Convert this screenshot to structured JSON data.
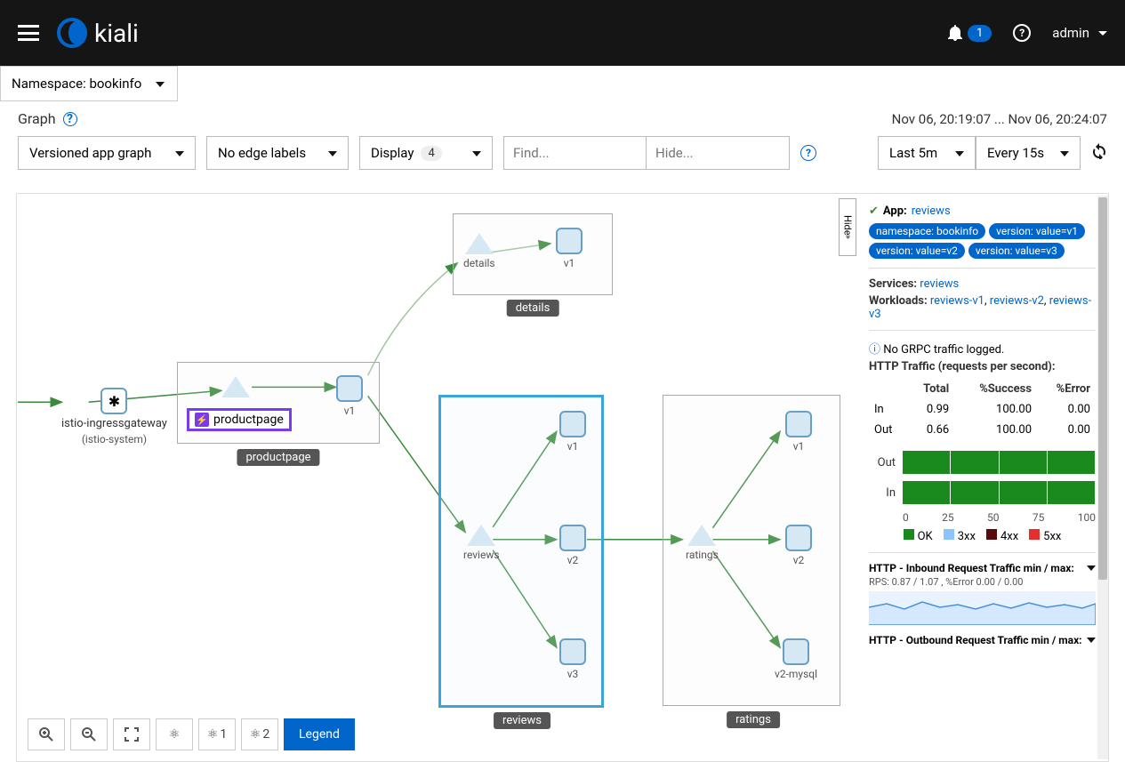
{
  "topbar": {
    "brand": "kiali",
    "notifications_count": "1",
    "user": "admin"
  },
  "namespace_selector": "Namespace: bookinfo",
  "page": {
    "title": "Graph",
    "timestamp": "Nov 06, 20:19:07 ... Nov 06, 20:24:07"
  },
  "toolbar": {
    "graph_type": "Versioned app graph",
    "edge_labels": "No edge labels",
    "display_label": "Display",
    "display_count": "4",
    "find_placeholder": "Find...",
    "hide_placeholder": "Hide...",
    "time_range": "Last 5m",
    "refresh_interval": "Every 15s"
  },
  "controls": {
    "layout1": "1",
    "layout2": "2",
    "legend": "Legend"
  },
  "hide_tab": "Hide",
  "graph": {
    "groups": {
      "productpage": {
        "label": "productpage"
      },
      "details": {
        "label": "details"
      },
      "reviews": {
        "label": "reviews"
      },
      "ratings": {
        "label": "ratings"
      }
    },
    "nodes": {
      "ingress": {
        "label": "istio-ingressgateway",
        "sublabel": "(istio-system)"
      },
      "productpage_svc": "productpage",
      "productpage_v1": "v1",
      "details_svc": "details",
      "details_v1": "v1",
      "reviews_svc": "reviews",
      "reviews_v1": "v1",
      "reviews_v2": "v2",
      "reviews_v3": "v3",
      "ratings_svc": "ratings",
      "ratings_v1": "v1",
      "ratings_v2": "v2",
      "ratings_v2mysql": "v2-mysql"
    }
  },
  "sidepanel": {
    "app_label": "App:",
    "app_name": "reviews",
    "chips": [
      "namespace: bookinfo",
      "version: value=v1",
      "version: value=v2",
      "version: value=v3"
    ],
    "services_label": "Services:",
    "services": "reviews",
    "workloads_label": "Workloads:",
    "workloads": [
      "reviews-v1",
      "reviews-v2",
      "reviews-v3"
    ],
    "grpc_msg": "No GRPC traffic logged.",
    "http_title": "HTTP Traffic (requests per second):",
    "table": {
      "headers": [
        "",
        "Total",
        "%Success",
        "%Error"
      ],
      "rows": [
        {
          "dir": "In",
          "total": "0.99",
          "success": "100.00",
          "error": "0.00"
        },
        {
          "dir": "Out",
          "total": "0.66",
          "success": "100.00",
          "error": "0.00"
        }
      ]
    },
    "bars": {
      "out": "Out",
      "in": "In",
      "ticks": [
        "0",
        "25",
        "50",
        "75",
        "100"
      ],
      "legend": [
        {
          "label": "OK",
          "color": "#1a8a1f"
        },
        {
          "label": "3xx",
          "color": "#8bc5ff"
        },
        {
          "label": "4xx",
          "color": "#5a0a0a"
        },
        {
          "label": "5xx",
          "color": "#e62e2e"
        }
      ]
    },
    "inbound": {
      "title": "HTTP - Inbound Request Traffic min / max:",
      "sub": "RPS: 0.87 / 1.07 , %Error 0.00 / 0.00"
    },
    "outbound": {
      "title": "HTTP - Outbound Request Traffic min / max:"
    }
  },
  "chart_data": {
    "type": "bar",
    "orientation": "horizontal-stacked",
    "categories": [
      "Out",
      "In"
    ],
    "series": [
      {
        "name": "OK",
        "values": [
          100,
          100
        ]
      },
      {
        "name": "3xx",
        "values": [
          0,
          0
        ]
      },
      {
        "name": "4xx",
        "values": [
          0,
          0
        ]
      },
      {
        "name": "5xx",
        "values": [
          0,
          0
        ]
      }
    ],
    "xlim": [
      0,
      100
    ],
    "xlabel": "",
    "ylabel": "",
    "title": ""
  }
}
